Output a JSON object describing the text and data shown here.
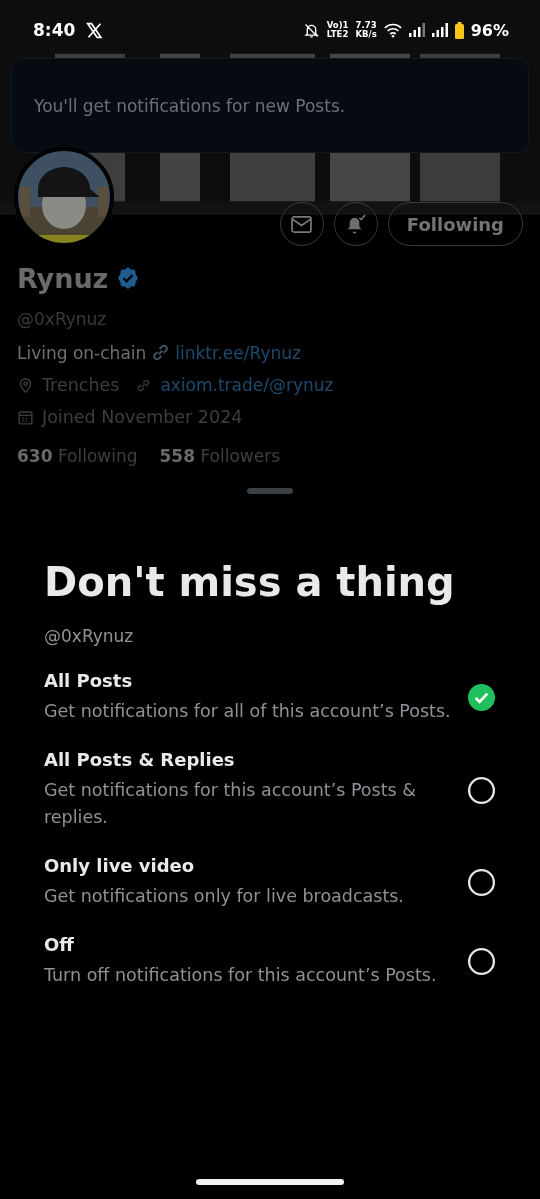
{
  "status_bar": {
    "time": "8:40",
    "network_lines": [
      "Vo)1",
      "LTE2"
    ],
    "speed_lines": [
      "7.73",
      "KB/s"
    ],
    "battery": "96%"
  },
  "toast": {
    "text": "You'll get notifications for new Posts."
  },
  "profile": {
    "name": "Rynuz",
    "verified": true,
    "handle": "@0xRynuz",
    "bio": "Living on-chain",
    "bio_link": "linktr.ee/Rynuz",
    "location": "Trenches",
    "website": "axiom.trade/@rynuz",
    "joined": "Joined November 2024",
    "following_count": "630",
    "following_label": "Following",
    "followers_count": "558",
    "followers_label": "Followers",
    "follow_button": "Following",
    "notifications_on": true
  },
  "sheet": {
    "title": "Don't miss a thing",
    "handle": "@0xRynuz",
    "options": [
      {
        "title": "All Posts",
        "description": "Get notifications for all of this account’s Posts.",
        "selected": true
      },
      {
        "title": "All Posts & Replies",
        "description": "Get notifications for this account’s Posts & replies.",
        "selected": false
      },
      {
        "title": "Only live video",
        "description": "Get notifications only for live broadcasts.",
        "selected": false
      },
      {
        "title": "Off",
        "description": "Turn off notifications for this account’s Posts.",
        "selected": false
      }
    ]
  }
}
